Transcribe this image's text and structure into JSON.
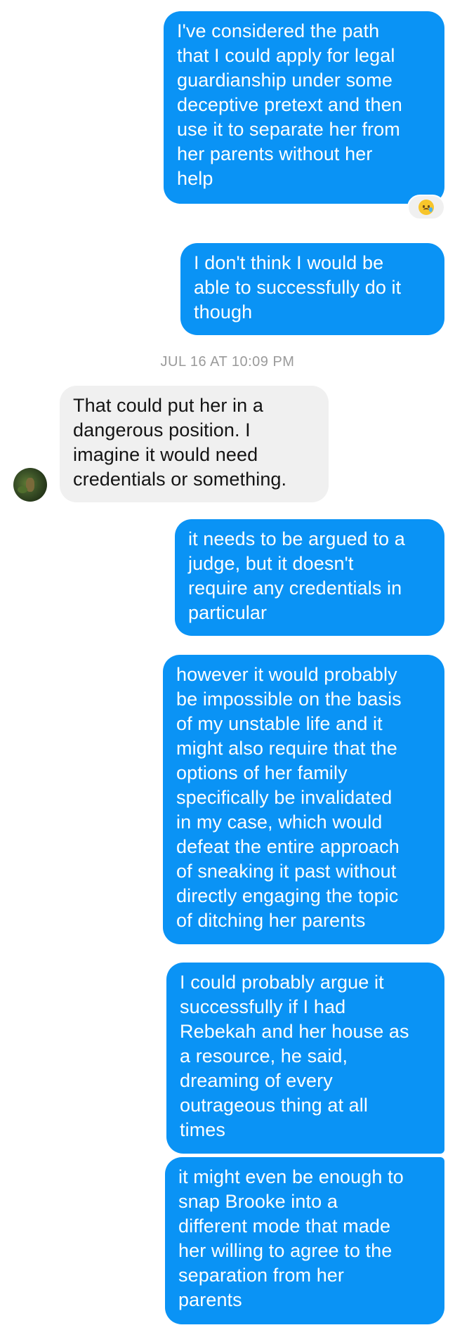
{
  "messages": [
    {
      "direction": "outgoing",
      "text": "I've considered the path\nthat I could apply for legal\nguardianship under some\ndeceptive pretext and then\nuse it to separate her from\nher parents without her\nhelp",
      "reaction": "crying-face"
    },
    {
      "direction": "outgoing",
      "text": "I don't think I would be\nable to successfully do it\nthough"
    },
    {
      "direction": "incoming",
      "text": "That could put her in a\ndangerous position. I\nimagine it would need\ncredentials or something."
    },
    {
      "direction": "outgoing",
      "text": "it needs to be argued to a\njudge, but it doesn't\nrequire any credentials in\nparticular"
    },
    {
      "direction": "outgoing",
      "text": "however it would probably\nbe impossible on the basis\nof my unstable life and it\nmight also require that the\noptions of her family\nspecifically be invalidated\nin my case, which would\ndefeat the entire approach\nof sneaking it past without\ndirectly engaging the topic\nof ditching her parents"
    },
    {
      "direction": "outgoing",
      "text": "I could probably argue it\nsuccessfully if I had\nRebekah and her house as\na resource, he said,\ndreaming of every\noutrageous thing at all\ntimes"
    },
    {
      "direction": "outgoing",
      "text": "it might even be enough to\nsnap Brooke into a\ndifferent mode that made\nher willing to agree to the\nseparation from her\nparents"
    }
  ],
  "timestamp": "JUL 16 AT 10:09 PM",
  "reaction_icon": "crying-face-icon",
  "colors": {
    "outgoing_bubble": "#0a93f5",
    "incoming_bubble": "#f0f0f0",
    "timestamp_text": "#9a9a9a"
  }
}
